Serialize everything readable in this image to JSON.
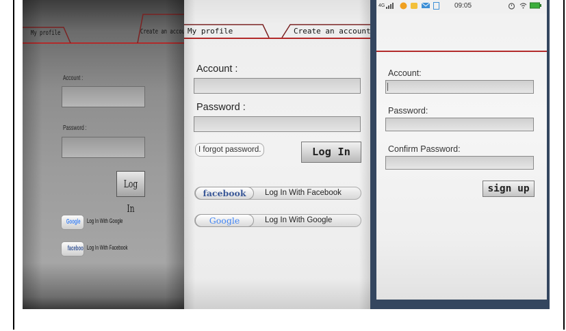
{
  "colors": {
    "accent_red": "#b22a2a",
    "facebook_blue": "#3b5998",
    "google_blue": "#4285f4",
    "google_red": "#db4437",
    "google_yellow": "#f4b400",
    "google_green": "#0f9d58",
    "phone_frame": "#34465f"
  },
  "panel1": {
    "tabs": {
      "left": "My profile",
      "right": "Create an account"
    },
    "account_label": "Account :",
    "password_label": "Password :",
    "login_button": "Log In",
    "google": {
      "badge": "Google",
      "text": "Log In With Google"
    },
    "facebook": {
      "badge": "facebook",
      "text": "Log In With Facebook"
    }
  },
  "panel2": {
    "tabs": {
      "left": "My profile",
      "right": "Create an account"
    },
    "account_label": "Account  :",
    "password_label": "Password  :",
    "forgot_link": "I forgot password.",
    "login_button": "Log In",
    "facebook": {
      "badge": "facebook",
      "text": "Log In With Facebook"
    },
    "google": {
      "badge": "Google",
      "text": "Log In With Google"
    }
  },
  "panel3": {
    "status_bar": {
      "network": "4G",
      "time": "09:05",
      "icons_left": [
        "signal-icon",
        "app-icon",
        "notification-icon",
        "mail-icon",
        "sim-icon"
      ],
      "icons_right": [
        "alarm-icon",
        "wifi-icon",
        "battery-icon"
      ]
    },
    "account_label": "Account:",
    "password_label": "Password:",
    "confirm_label": "Confirm Password:",
    "signup_button": "sign up"
  }
}
